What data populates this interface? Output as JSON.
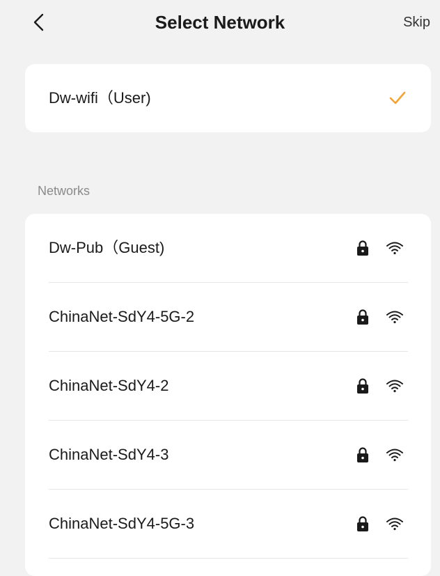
{
  "header": {
    "title": "Select Network",
    "skip_label": "Skip"
  },
  "current_network": {
    "name": "Dw-wifi（User)",
    "selected": true,
    "check_color": "#f5a231"
  },
  "networks_section": {
    "label": "Networks",
    "items": [
      {
        "name": "Dw-Pub（Guest)",
        "locked": true
      },
      {
        "name": "ChinaNet-SdY4-5G-2",
        "locked": true
      },
      {
        "name": "ChinaNet-SdY4-2",
        "locked": true
      },
      {
        "name": "ChinaNet-SdY4-3",
        "locked": true
      },
      {
        "name": "ChinaNet-SdY4-5G-3",
        "locked": true
      }
    ]
  },
  "icons": {
    "back": "chevron-left-icon",
    "check": "checkmark-icon",
    "lock": "lock-icon",
    "wifi": "wifi-icon"
  },
  "colors": {
    "background": "#f2f2f2",
    "card": "#ffffff",
    "accent": "#f5a231",
    "muted_text": "#8a8a8a"
  }
}
